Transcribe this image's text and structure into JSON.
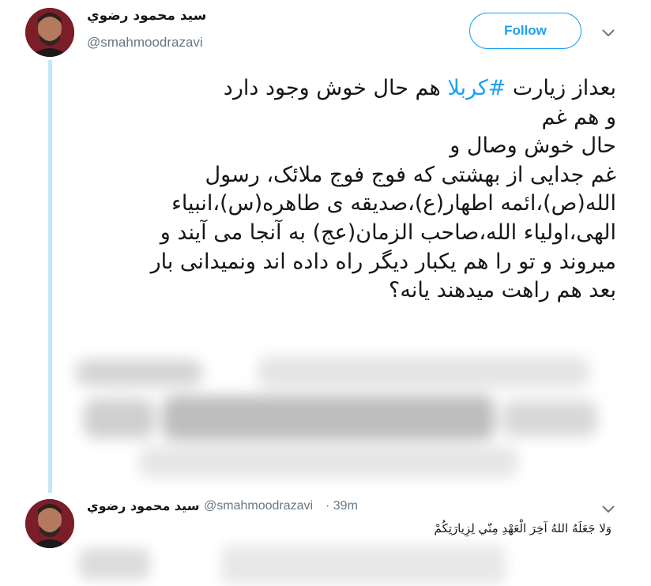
{
  "tweet": {
    "author_name": "سید محمود رضوي",
    "author_handle": "@smahmoodrazavi",
    "follow_label": "Follow",
    "text_lines": [
      {
        "before": "بعداز زیارت ",
        "hashtag": "#کربلا",
        "after": " هم حال خوش وجود دارد"
      },
      {
        "before": "و هم غم"
      },
      {
        "before": "حال خوش وصال و"
      },
      {
        "before": "غم جدایی از بهشتی که فوج فوج ملائک، رسول"
      },
      {
        "before": "الله(ص)،ائمه اطهار(ع)،صدیقه ی طاهره(س)،انبیاء"
      },
      {
        "before": "الهی،اولیاء الله،صاحب الزمان(عج) به آنجا می آیند و"
      },
      {
        "before": "میروند و تو را هم یکبار دیگر راه داده اند ونمیدانی بار"
      },
      {
        "before": "بعد هم راهت میدهند یانه؟"
      }
    ]
  },
  "reply": {
    "author_name": "سید محمود رضوي",
    "author_handle": "@smahmoodrazavi",
    "time": "· 39m",
    "text": "وَلا جَعَلَهُ اللهُ آخِرَ الْعَهْدِ مِنّي لِزِيارَتِكُمْ"
  },
  "icons": {
    "avatar": "profile-photo",
    "chevron": "chevron-down-icon"
  },
  "colors": {
    "accent": "#1da1f2",
    "thread_line": "#c4e5f9",
    "secondary_text": "#657786"
  }
}
